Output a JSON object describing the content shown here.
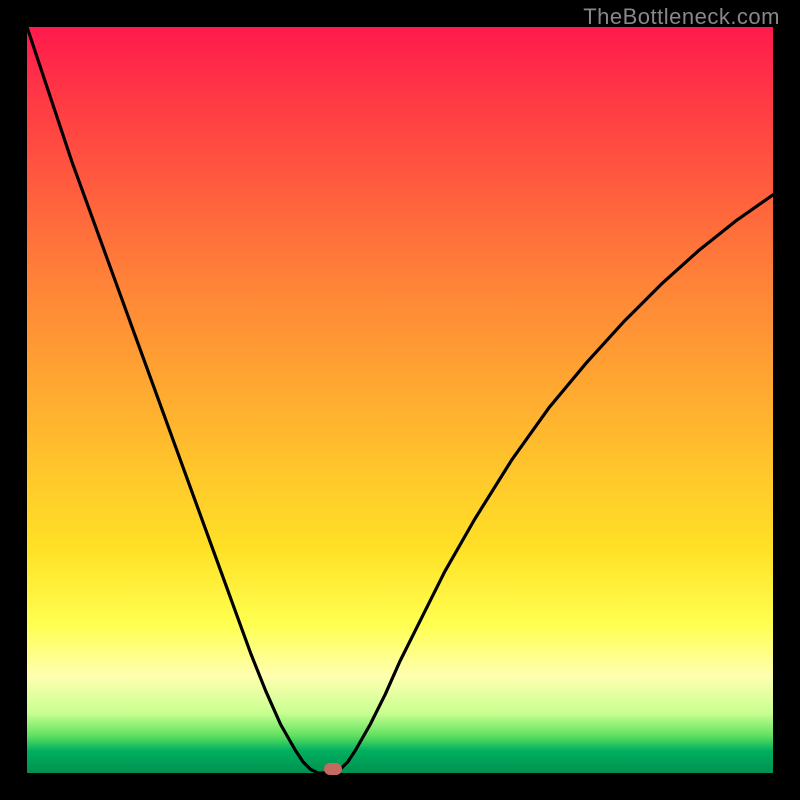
{
  "watermark": "TheBottleneck.com",
  "colors": {
    "frame": "#000000",
    "curve": "#000000",
    "marker": "#c46a5f",
    "gradient_stops": [
      "#ff1a4d",
      "#ff3a44",
      "#ff5e3e",
      "#ff8238",
      "#ffa232",
      "#ffc22c",
      "#ffe126",
      "#ffff50",
      "#ffffb0",
      "#c8ff90",
      "#60e060",
      "#00b060",
      "#009050"
    ]
  },
  "chart_data": {
    "type": "line",
    "title": "",
    "xlabel": "",
    "ylabel": "",
    "xlim": [
      0,
      100
    ],
    "ylim": [
      0,
      100
    ],
    "x": [
      0,
      2,
      4,
      6,
      8,
      10,
      12,
      14,
      16,
      18,
      20,
      22,
      24,
      26,
      28,
      30,
      32,
      34,
      36,
      37,
      38,
      39,
      40,
      41,
      42,
      43,
      44,
      46,
      48,
      50,
      53,
      56,
      60,
      65,
      70,
      75,
      80,
      85,
      90,
      95,
      100
    ],
    "y": [
      100,
      94,
      88,
      82,
      76.5,
      71,
      65.5,
      60,
      54.5,
      49,
      43.5,
      38,
      32.5,
      27,
      21.5,
      16,
      11,
      6.5,
      3,
      1.5,
      0.5,
      0,
      0,
      0,
      0.5,
      1.5,
      3,
      6.5,
      10.5,
      15,
      21,
      27,
      34,
      42,
      49,
      55,
      60.5,
      65.5,
      70,
      74,
      77.5
    ],
    "marker": {
      "x": 41,
      "y": 0.5
    },
    "notes": "V-shaped bottleneck curve; minimum (optimal balance) around x≈40–41. Axes are unlabeled in the source image; x is an implicit component-strength axis and y is estimated bottleneck percentage."
  }
}
